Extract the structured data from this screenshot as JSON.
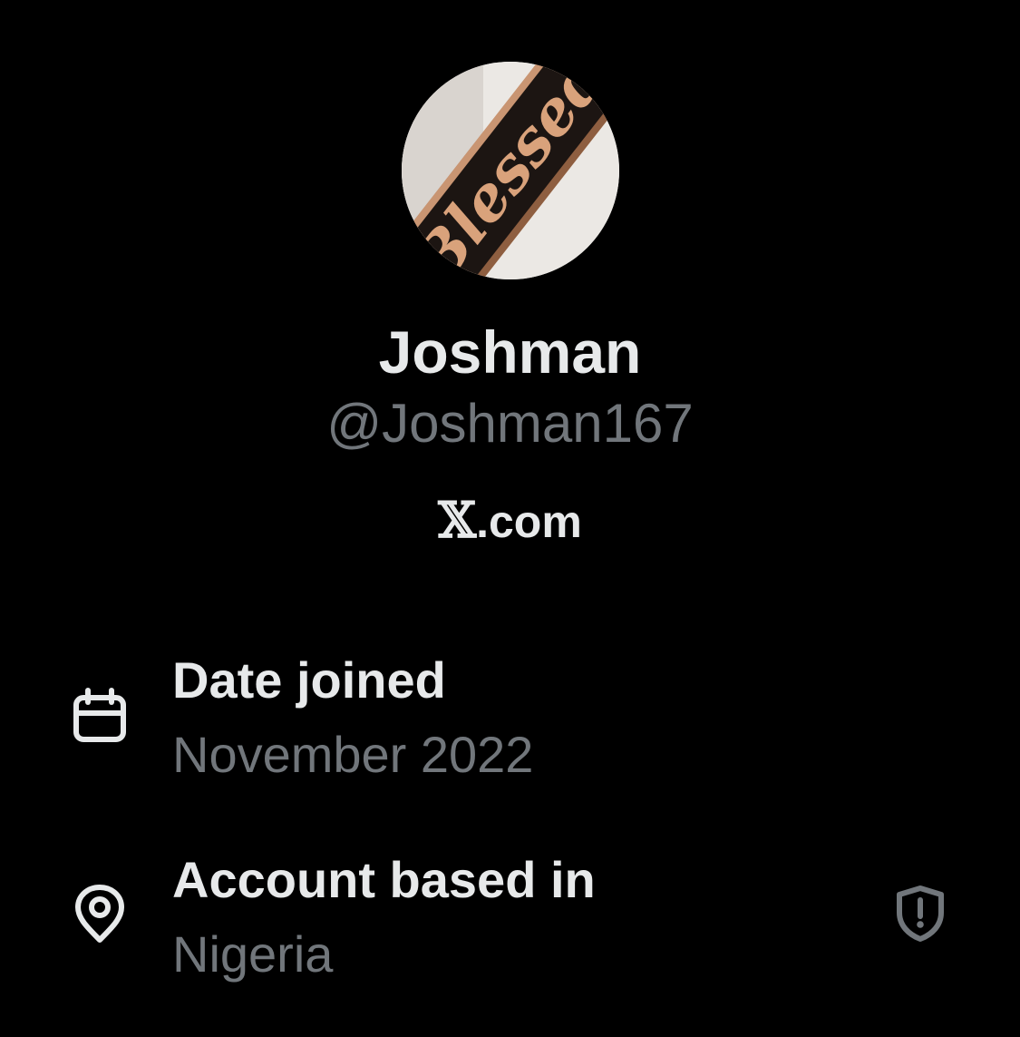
{
  "profile": {
    "display_name": "Joshman",
    "handle": "@Joshman167",
    "avatar_text": "Blessed",
    "source_logo": "𝕏",
    "source_text": ".com"
  },
  "details": {
    "date_joined": {
      "icon": "calendar-icon",
      "label": "Date joined",
      "value": "November 2022"
    },
    "account_based_in": {
      "icon": "location-pin-icon",
      "label": "Account based in",
      "value": "Nigeria",
      "badge_icon": "shield-alert-icon"
    }
  },
  "colors": {
    "background": "#000000",
    "primary_text": "#e7e9ea",
    "secondary_text": "#71767b"
  }
}
